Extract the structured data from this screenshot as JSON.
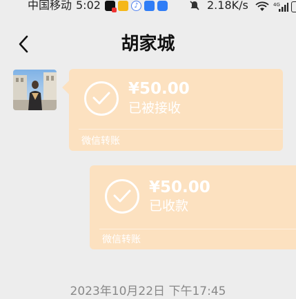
{
  "status_bar": {
    "carrier": "中国移动",
    "time": "5:02",
    "speed": "2.18K/s",
    "network": "4G",
    "apps": [
      "tiktok-icon",
      "file-manager-icon",
      "music-icon",
      "browser-icon",
      "chat-app-icon"
    ]
  },
  "header": {
    "title": "胡家城"
  },
  "messages": [
    {
      "direction": "incoming",
      "amount": "¥50.00",
      "status": "已被接收",
      "label": "微信转账"
    },
    {
      "direction": "outgoing",
      "amount": "¥50.00",
      "status": "已收款",
      "label": "微信转账"
    }
  ],
  "timestamp": "2023年10月22日 下午17:45",
  "colors": {
    "background": "#ededed",
    "transfer_bubble": "#fce1c0",
    "text_on_bubble": "#ffffff"
  }
}
